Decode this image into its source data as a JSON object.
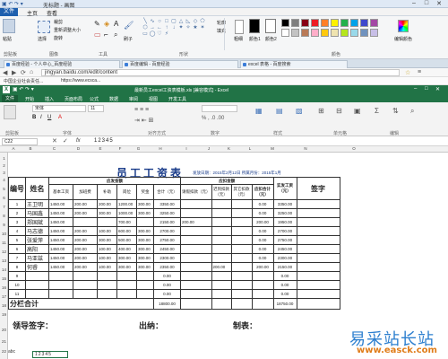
{
  "paint": {
    "title": "无标题 - 画图",
    "menu": {
      "file": "文件",
      "tabs": [
        "主页",
        "查看"
      ]
    },
    "groups": {
      "clipboard": "剪贴板",
      "image": "图像",
      "tools": "工具",
      "shapes": "形状",
      "colors": "颜色"
    },
    "ribbon": {
      "paste": "粘贴",
      "crop": "裁剪",
      "resize": "重新调整大小",
      "rotate": "旋转",
      "select": "选择",
      "brushes": "刷子",
      "outline": "轮廓",
      "fill": "填充",
      "size": "粗细",
      "color1": "颜色1",
      "color2": "颜色2",
      "edit_colors": "编辑颜色"
    },
    "palette": [
      "#000000",
      "#7f7f7f",
      "#880015",
      "#ed1c24",
      "#ff7f27",
      "#fff200",
      "#22b14c",
      "#00a2e8",
      "#3f48cc",
      "#a349a4",
      "#ffffff",
      "#c3c3c3",
      "#b97a57",
      "#ffaec9",
      "#ffc90e",
      "#efe4b0",
      "#b5e61d",
      "#99d9ea",
      "#7092be",
      "#c8bfe7"
    ]
  },
  "browser": {
    "tabs": [
      "百度经验 - 个人中心_百度经验",
      "百度编辑 - 百度经验",
      "excel 表格 - 百度搜索"
    ],
    "url": "jingyan.baidu.com/edit/content",
    "favorites": [
      "中国企业社会责任...",
      "https://www.ecsca..."
    ]
  },
  "excel": {
    "title": "最新员工excel工资表模板.xls [兼容模式] - Excel",
    "file": "文件",
    "tabs": [
      "开始",
      "插入",
      "页面布局",
      "公式",
      "数据",
      "审阅",
      "视图",
      "开发工具"
    ],
    "font_name": "宋体",
    "font_size": "11",
    "groups": [
      "剪贴板",
      "字体",
      "对齐方式",
      "数字",
      "样式",
      "单元格",
      "编辑"
    ],
    "name_box": "C22",
    "fx": "fx",
    "formula_value": "12345",
    "columns": [
      "A",
      "B",
      "C",
      "D",
      "E",
      "F",
      "G",
      "H",
      "I",
      "J",
      "K",
      "L",
      "M",
      "N",
      "O"
    ],
    "rows": [
      "1",
      "2",
      "3",
      "4",
      "5",
      "6",
      "7",
      "8",
      "9",
      "10",
      "11",
      "12",
      "13",
      "14",
      "15",
      "16",
      "17",
      "18",
      "19",
      "20",
      "21",
      "22"
    ],
    "sheet_tab": "abc"
  },
  "sheet": {
    "title": "员工工资表",
    "meta": "发放日期：2015年2月12日  所属月份：2015年1月",
    "headers": {
      "no": "编号",
      "name": "姓名",
      "payable": "应发金额",
      "deduct": "应扣金额",
      "base": "基本工资",
      "overtime": "加班费",
      "subsidy": "补助",
      "position": "岗位",
      "bonus": "奖金",
      "total": "合计（元）",
      "leave": "请假扣款（元）",
      "late": "迟到扣款（元）",
      "other": "其它扣款（元）",
      "deduct_total": "应扣合计（元）",
      "actual": "实发工资（元）",
      "sign": "签字"
    },
    "rows": [
      {
        "no": "1",
        "name": "王卫明",
        "base": "1450.00",
        "ot": "200.00",
        "sub": "200.00",
        "pos": "1200.00",
        "bonus": "300.00",
        "total": "3350.00",
        "leave": "",
        "late": "",
        "other": "",
        "dtotal": "0.00",
        "actual": "3350.00"
      },
      {
        "no": "2",
        "name": "马国鑫",
        "base": "1450.00",
        "ot": "200.00",
        "sub": "300.00",
        "pos": "1000.00",
        "bonus": "300.00",
        "total": "3250.00",
        "leave": "",
        "late": "",
        "other": "",
        "dtotal": "0.00",
        "actual": "3250.00"
      },
      {
        "no": "3",
        "name": "郑国斌",
        "base": "1450.00",
        "ot": "",
        "sub": "",
        "pos": "700.00",
        "bonus": "",
        "total": "2150.00",
        "leave": "200.00",
        "late": "",
        "other": "",
        "dtotal": "200.00",
        "actual": "1950.00"
      },
      {
        "no": "4",
        "name": "马志德",
        "base": "1450.00",
        "ot": "200.00",
        "sub": "100.00",
        "pos": "600.00",
        "bonus": "300.00",
        "total": "2700.00",
        "leave": "",
        "late": "",
        "other": "",
        "dtotal": "0.00",
        "actual": "2700.00"
      },
      {
        "no": "5",
        "name": "张爱萍",
        "base": "1450.00",
        "ot": "200.00",
        "sub": "300.00",
        "pos": "500.00",
        "bonus": "300.00",
        "total": "2750.00",
        "leave": "",
        "late": "",
        "other": "",
        "dtotal": "0.00",
        "actual": "2750.00"
      },
      {
        "no": "6",
        "name": "高阳",
        "base": "1450.00",
        "ot": "200.00",
        "sub": "100.00",
        "pos": "400.00",
        "bonus": "300.00",
        "total": "2450.00",
        "leave": "",
        "late": "",
        "other": "",
        "dtotal": "0.00",
        "actual": "2450.00"
      },
      {
        "no": "7",
        "name": "马亚兹",
        "base": "1450.00",
        "ot": "200.00",
        "sub": "100.00",
        "pos": "300.00",
        "bonus": "300.00",
        "total": "2300.00",
        "leave": "",
        "late": "",
        "other": "",
        "dtotal": "0.00",
        "actual": "2300.00"
      },
      {
        "no": "8",
        "name": "何睿",
        "base": "1450.00",
        "ot": "200.00",
        "sub": "100.00",
        "pos": "300.00",
        "bonus": "300.00",
        "total": "2350.00",
        "leave": "",
        "late": "200.00",
        "other": "",
        "dtotal": "200.00",
        "actual": "2150.00"
      },
      {
        "no": "9",
        "name": "",
        "base": "",
        "ot": "",
        "sub": "",
        "pos": "",
        "bonus": "",
        "total": "0.00",
        "leave": "",
        "late": "",
        "other": "",
        "dtotal": "",
        "actual": "0.00"
      },
      {
        "no": "10",
        "name": "",
        "base": "",
        "ot": "",
        "sub": "",
        "pos": "",
        "bonus": "",
        "total": "0.00",
        "leave": "",
        "late": "",
        "other": "",
        "dtotal": "",
        "actual": "0.00"
      },
      {
        "no": "11",
        "name": "",
        "base": "",
        "ot": "",
        "sub": "",
        "pos": "",
        "bonus": "",
        "total": "0.00",
        "leave": "",
        "late": "",
        "other": "",
        "dtotal": "",
        "actual": "0.00"
      }
    ],
    "subtotal_label": "分栏合计",
    "subtotal_total": "18800.00",
    "subtotal_actual": "18750.00",
    "sign_leader": "领导签字：",
    "sign_cashier": "出纳：",
    "sign_maker": "制表：",
    "cell_value": "12345"
  },
  "watermark": {
    "cn": "易采站长站",
    "en": "www.easck.com"
  }
}
